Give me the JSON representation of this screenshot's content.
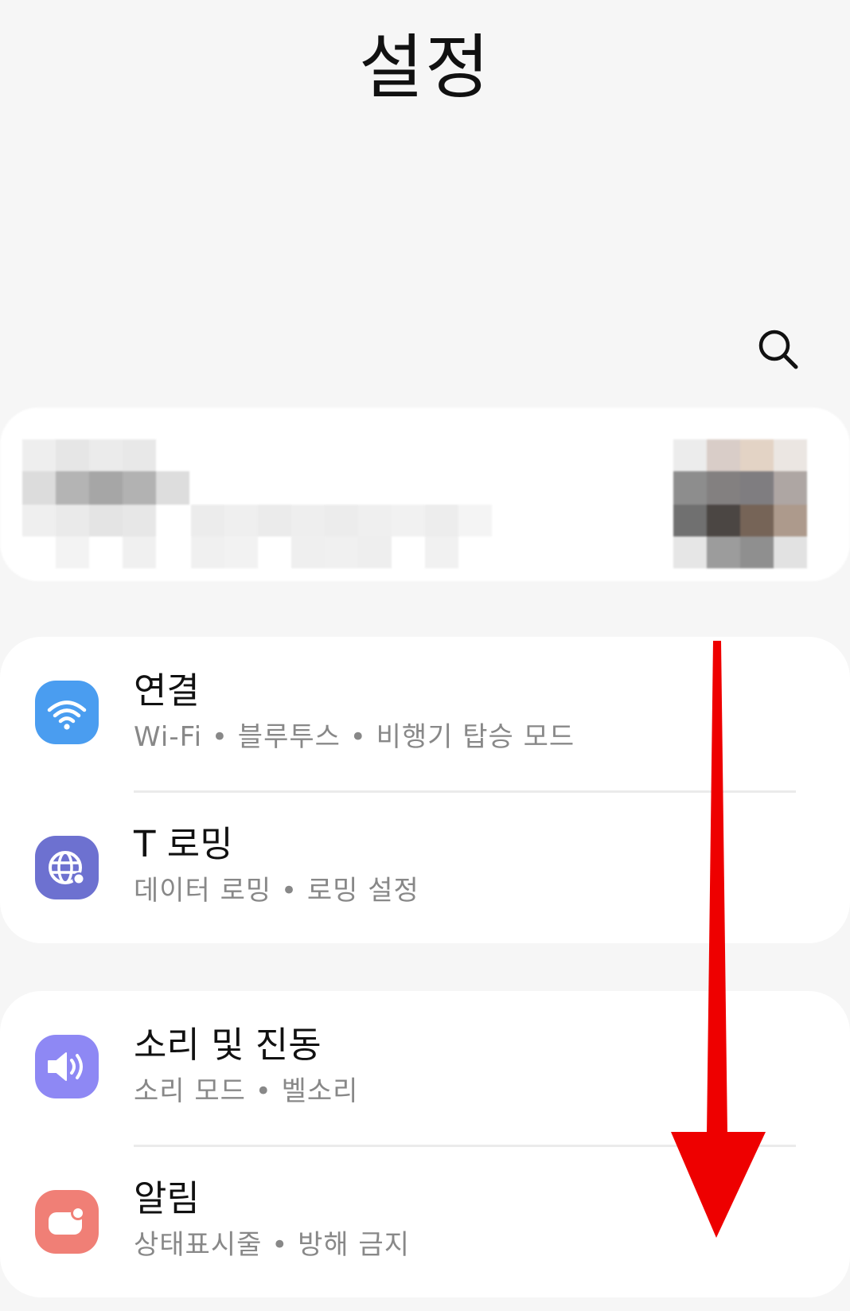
{
  "header": {
    "title": "설정"
  },
  "search": {
    "icon": "search-icon"
  },
  "account": {
    "state": "redacted"
  },
  "groups": [
    {
      "rows": [
        {
          "icon": "wifi-icon",
          "icon_color": "#4a9df0",
          "title": "연결",
          "subtitle": "Wi-Fi  •  블루투스  •  비행기 탑승 모드"
        },
        {
          "icon": "globe-icon",
          "icon_color": "#6d71d0",
          "title": "T 로밍",
          "subtitle": "데이터 로밍  •  로밍 설정"
        }
      ]
    },
    {
      "rows": [
        {
          "icon": "speaker-icon",
          "icon_color": "#8e88f4",
          "title": "소리 및 진동",
          "subtitle": "소리 모드  •  벨소리"
        },
        {
          "icon": "notification-icon",
          "icon_color": "#f07f76",
          "title": "알림",
          "subtitle": "상태표시줄  •  방해 금지"
        }
      ]
    }
  ],
  "annotation": {
    "type": "scroll-down-arrow",
    "color": "#ee0000"
  }
}
